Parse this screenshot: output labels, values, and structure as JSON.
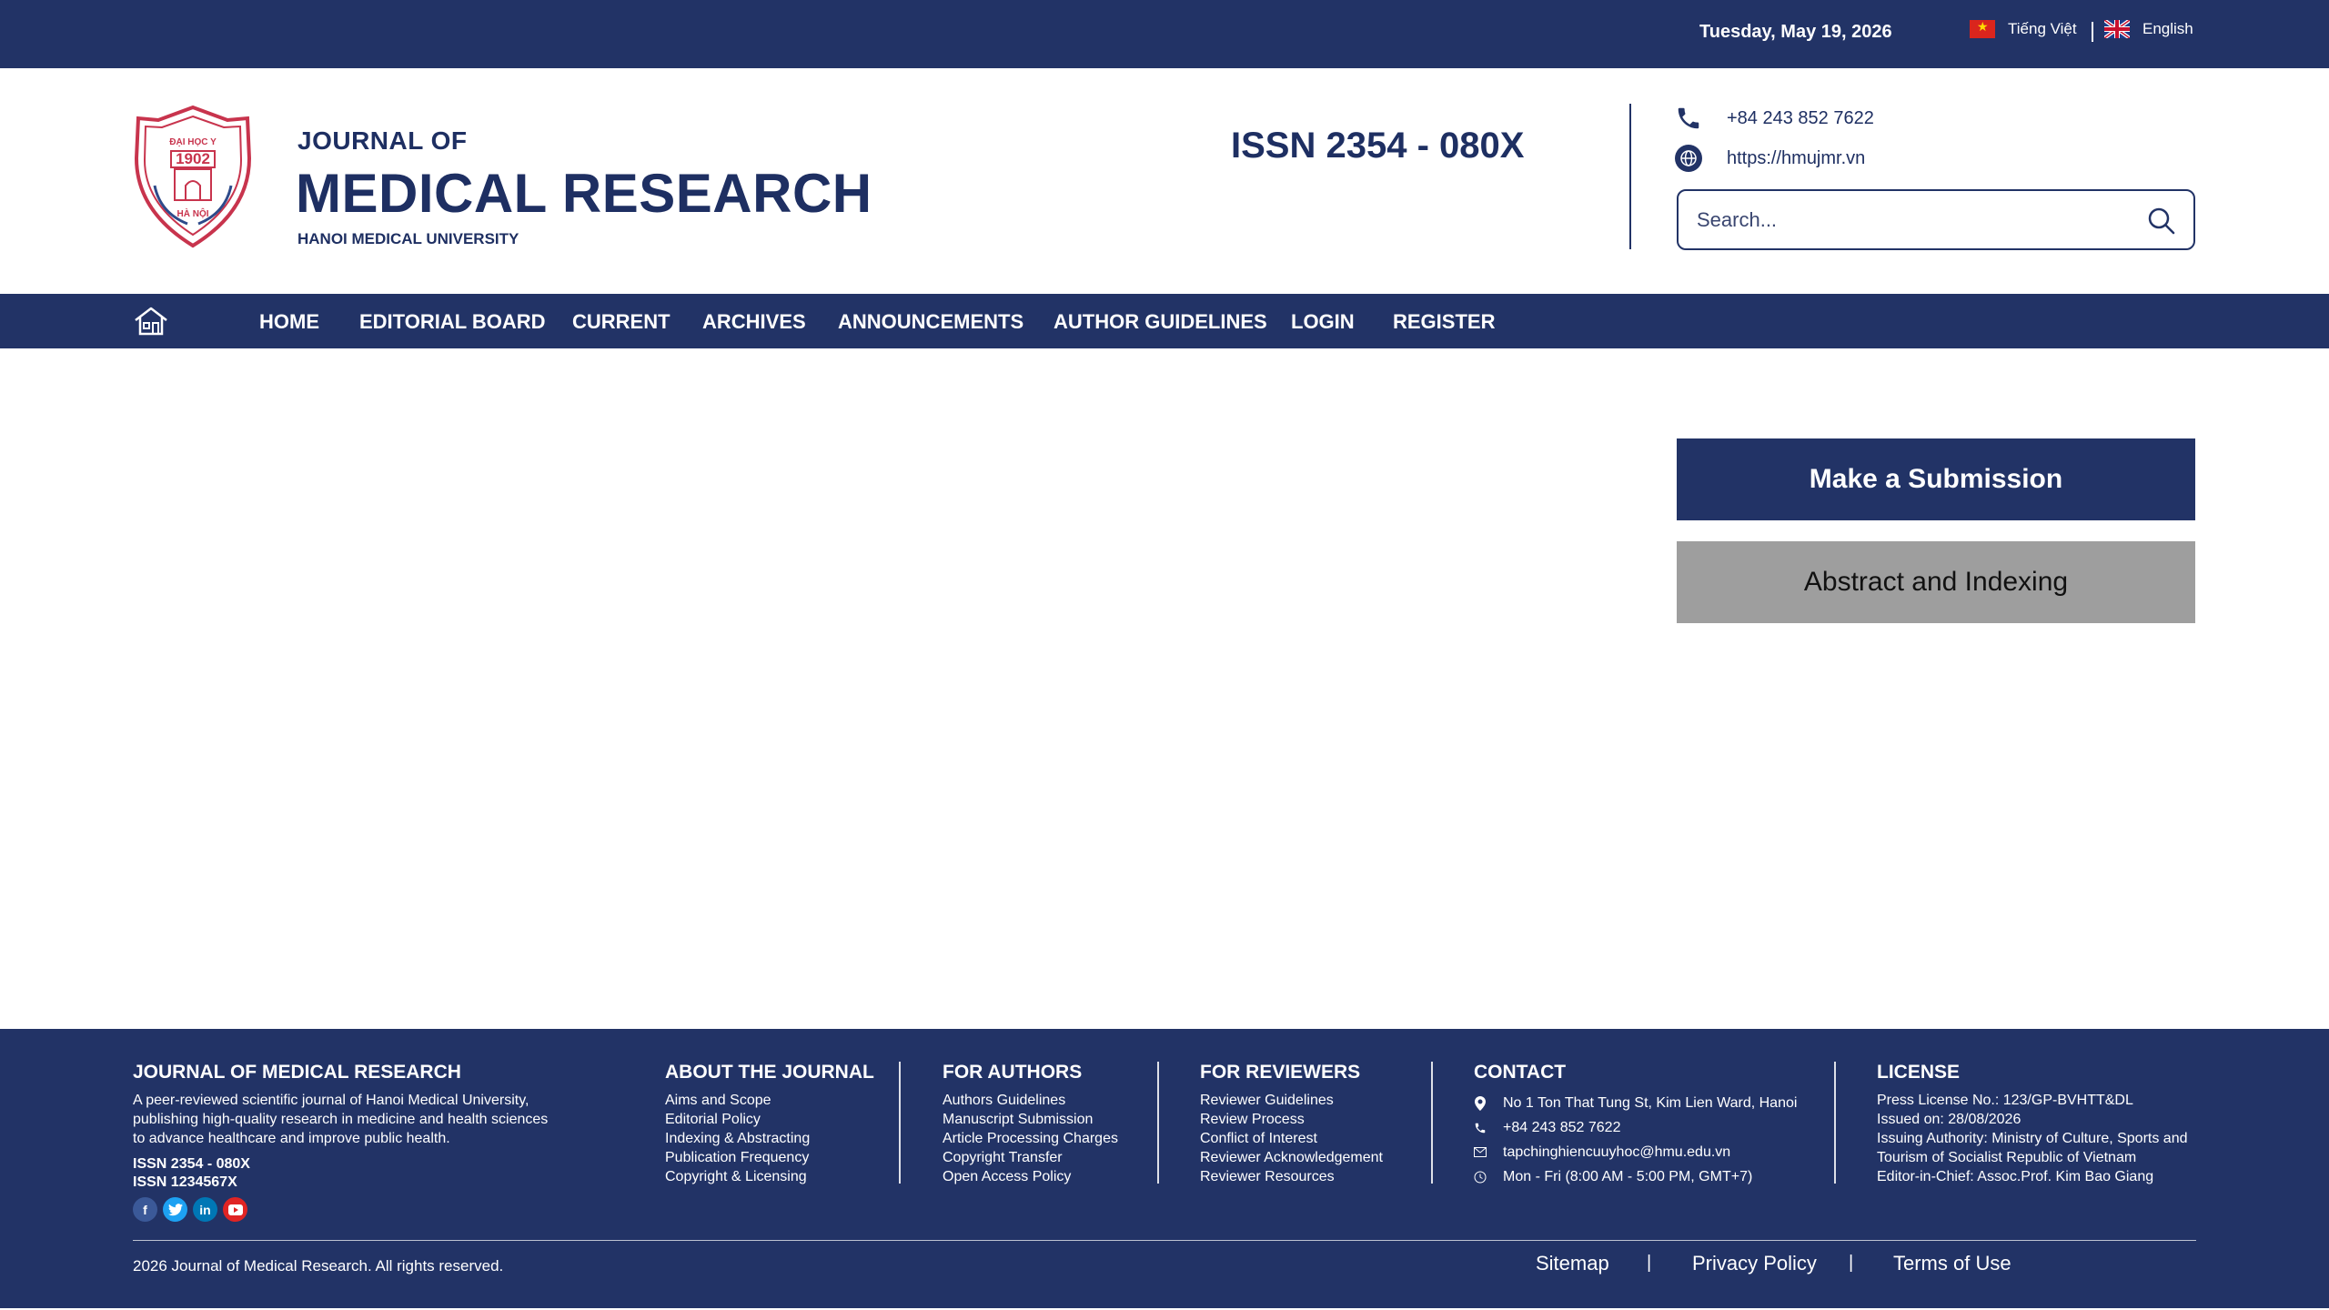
{
  "topbar": {
    "date": "Tuesday, May 19, 2026",
    "lang_vi": "Tiếng Việt",
    "lang_en": "English"
  },
  "header": {
    "logo_text_top": "ĐẠI HỌC Y",
    "logo_year": "1902",
    "logo_text_bottom": "HÀ NỘI",
    "journal_small": "JOURNAL OF",
    "journal_big": "MEDICAL RESEARCH",
    "university": "HANOI MEDICAL UNIVERSITY",
    "issn": "ISSN 2354 - 080X",
    "phone": "+84 243 852 7622",
    "website": "https://hmujmr.vn",
    "search_placeholder": "Search..."
  },
  "nav": {
    "items": [
      "HOME",
      "EDITORIAL BOARD",
      "CURRENT",
      "ARCHIVES",
      "ANNOUNCEMENTS",
      "AUTHOR GUIDELINES",
      "LOGIN",
      "REGISTER"
    ]
  },
  "sidebar": {
    "submit_label": "Make a Submission",
    "index_label": "Abstract and Indexing"
  },
  "footer": {
    "about": {
      "title": "JOURNAL OF MEDICAL RESEARCH",
      "desc_lines": [
        "A peer-reviewed scientific journal of Hanoi Medical University,",
        "publishing high-quality research in medicine and health sciences",
        "to advance healthcare and improve public health."
      ],
      "issn1": "ISSN 2354 - 080X",
      "issn2": "ISSN 1234567X"
    },
    "about_journal": {
      "title": "ABOUT THE JOURNAL",
      "links": [
        "Aims and Scope",
        "Editorial Policy",
        "Indexing & Abstracting",
        "Publication Frequency",
        "Copyright & Licensing"
      ]
    },
    "for_authors": {
      "title": "FOR AUTHORS",
      "links": [
        "Authors Guidelines",
        "Manuscript Submission",
        "Article Processing Charges",
        "Copyright Transfer",
        "Open Access Policy"
      ]
    },
    "for_reviewers": {
      "title": "FOR REVIEWERS",
      "links": [
        "Reviewer Guidelines",
        "Review Process",
        "Conflict of Interest",
        "Reviewer Acknowledgement",
        "Reviewer Resources"
      ]
    },
    "contact": {
      "title": "CONTACT",
      "address": "No 1 Ton That Tung St, Kim Lien Ward, Hanoi",
      "phone": "+84 243 852 7622",
      "email": "tapchinghiencuuyhoc@hmu.edu.vn",
      "hours": "Mon - Fri (8:00 AM - 5:00 PM, GMT+7)"
    },
    "license": {
      "title": "LICENSE",
      "lines": [
        "Press License No.: 123/GP-BVHTT&DL",
        "Issued on: 28/08/2026",
        "Issuing Authority: Ministry of Culture, Sports and",
        "Tourism of Socialist Republic of Vietnam",
        "Editor-in-Chief: Assoc.Prof. Kim Bao Giang"
      ]
    },
    "copyright": "2026 Journal of Medical Research. All rights reserved.",
    "sitemap": "Sitemap",
    "privacy": "Privacy Policy",
    "terms": "Terms of Use",
    "separator": "|"
  },
  "colors": {
    "navy": "#223366",
    "button_gray": "#9e9e9e",
    "logo_red": "#c8344d"
  },
  "icons": [
    "home-icon",
    "phone-icon",
    "globe-icon",
    "search-icon",
    "facebook-icon",
    "twitter-icon",
    "linkedin-icon",
    "youtube-icon",
    "location-icon",
    "mail-icon",
    "clock-icon"
  ]
}
